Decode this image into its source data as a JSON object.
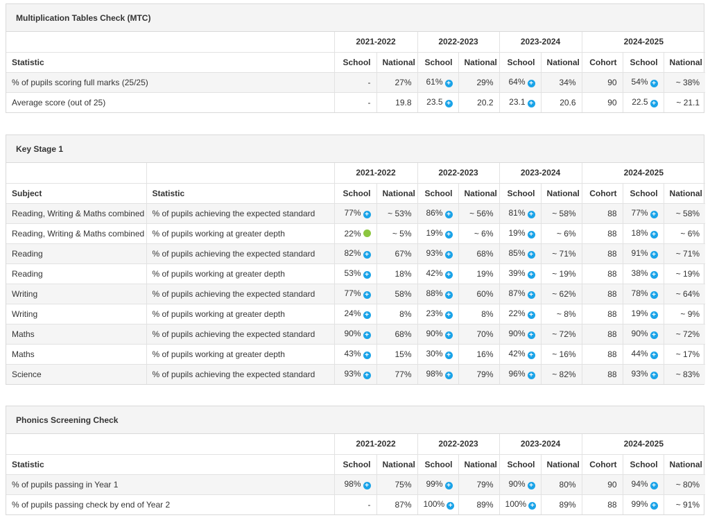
{
  "colors": {
    "info_icon": "#1aa3e8",
    "green_dot": "#8cc63f"
  },
  "years": [
    "2021-2022",
    "2022-2023",
    "2023-2024",
    "2024-2025"
  ],
  "columns": {
    "school": "School",
    "national": "National",
    "cohort": "Cohort"
  },
  "mtc": {
    "title": "Multiplication Tables Check (MTC)",
    "statistic_header": "Statistic",
    "rows": [
      {
        "statistic": "% of pupils scoring full marks (25/25)",
        "cells": [
          {
            "v": "-",
            "icon": ""
          },
          {
            "v": "27%",
            "icon": ""
          },
          {
            "v": "61%",
            "icon": "info-icon"
          },
          {
            "v": "29%",
            "icon": ""
          },
          {
            "v": "64%",
            "icon": "info-icon"
          },
          {
            "v": "34%",
            "icon": ""
          },
          {
            "v": "90",
            "icon": ""
          },
          {
            "v": "54%",
            "icon": "info-icon"
          },
          {
            "v": "~ 38%",
            "icon": ""
          }
        ]
      },
      {
        "statistic": "Average score (out of 25)",
        "cells": [
          {
            "v": "-",
            "icon": ""
          },
          {
            "v": "19.8",
            "icon": ""
          },
          {
            "v": "23.5",
            "icon": "info-icon"
          },
          {
            "v": "20.2",
            "icon": ""
          },
          {
            "v": "23.1",
            "icon": "info-icon"
          },
          {
            "v": "20.6",
            "icon": ""
          },
          {
            "v": "90",
            "icon": ""
          },
          {
            "v": "22.5",
            "icon": "info-icon"
          },
          {
            "v": "~ 21.1",
            "icon": ""
          }
        ]
      }
    ]
  },
  "ks1": {
    "title": "Key Stage 1",
    "subject_header": "Subject",
    "statistic_header": "Statistic",
    "rows": [
      {
        "subject": "Reading, Writing & Maths combined",
        "statistic": "% of pupils achieving the expected standard",
        "cells": [
          {
            "v": "77%",
            "icon": "info-icon"
          },
          {
            "v": "~ 53%",
            "icon": ""
          },
          {
            "v": "86%",
            "icon": "info-icon"
          },
          {
            "v": "~ 56%",
            "icon": ""
          },
          {
            "v": "81%",
            "icon": "info-icon"
          },
          {
            "v": "~ 58%",
            "icon": ""
          },
          {
            "v": "88",
            "icon": ""
          },
          {
            "v": "77%",
            "icon": "info-icon"
          },
          {
            "v": "~ 58%",
            "icon": ""
          }
        ]
      },
      {
        "subject": "Reading, Writing & Maths combined",
        "statistic": "% of pupils working at greater depth",
        "cells": [
          {
            "v": "22%",
            "icon": "green-dot-icon"
          },
          {
            "v": "~ 5%",
            "icon": ""
          },
          {
            "v": "19%",
            "icon": "info-icon"
          },
          {
            "v": "~ 6%",
            "icon": ""
          },
          {
            "v": "19%",
            "icon": "info-icon"
          },
          {
            "v": "~ 6%",
            "icon": ""
          },
          {
            "v": "88",
            "icon": ""
          },
          {
            "v": "18%",
            "icon": "info-icon"
          },
          {
            "v": "~ 6%",
            "icon": ""
          }
        ]
      },
      {
        "subject": "Reading",
        "statistic": "% of pupils achieving the expected standard",
        "cells": [
          {
            "v": "82%",
            "icon": "info-icon"
          },
          {
            "v": "67%",
            "icon": ""
          },
          {
            "v": "93%",
            "icon": "info-icon"
          },
          {
            "v": "68%",
            "icon": ""
          },
          {
            "v": "85%",
            "icon": "info-icon"
          },
          {
            "v": "~ 71%",
            "icon": ""
          },
          {
            "v": "88",
            "icon": ""
          },
          {
            "v": "91%",
            "icon": "info-icon"
          },
          {
            "v": "~ 71%",
            "icon": ""
          }
        ]
      },
      {
        "subject": "Reading",
        "statistic": "% of pupils working at greater depth",
        "cells": [
          {
            "v": "53%",
            "icon": "info-icon"
          },
          {
            "v": "18%",
            "icon": ""
          },
          {
            "v": "42%",
            "icon": "info-icon"
          },
          {
            "v": "19%",
            "icon": ""
          },
          {
            "v": "39%",
            "icon": "info-icon"
          },
          {
            "v": "~ 19%",
            "icon": ""
          },
          {
            "v": "88",
            "icon": ""
          },
          {
            "v": "38%",
            "icon": "info-icon"
          },
          {
            "v": "~ 19%",
            "icon": ""
          }
        ]
      },
      {
        "subject": "Writing",
        "statistic": "% of pupils achieving the expected standard",
        "cells": [
          {
            "v": "77%",
            "icon": "info-icon"
          },
          {
            "v": "58%",
            "icon": ""
          },
          {
            "v": "88%",
            "icon": "info-icon"
          },
          {
            "v": "60%",
            "icon": ""
          },
          {
            "v": "87%",
            "icon": "info-icon"
          },
          {
            "v": "~ 62%",
            "icon": ""
          },
          {
            "v": "88",
            "icon": ""
          },
          {
            "v": "78%",
            "icon": "info-icon"
          },
          {
            "v": "~ 64%",
            "icon": ""
          }
        ]
      },
      {
        "subject": "Writing",
        "statistic": "% of pupils working at greater depth",
        "cells": [
          {
            "v": "24%",
            "icon": "info-icon"
          },
          {
            "v": "8%",
            "icon": ""
          },
          {
            "v": "23%",
            "icon": "info-icon"
          },
          {
            "v": "8%",
            "icon": ""
          },
          {
            "v": "22%",
            "icon": "info-icon"
          },
          {
            "v": "~ 8%",
            "icon": ""
          },
          {
            "v": "88",
            "icon": ""
          },
          {
            "v": "19%",
            "icon": "info-icon"
          },
          {
            "v": "~ 9%",
            "icon": ""
          }
        ]
      },
      {
        "subject": "Maths",
        "statistic": "% of pupils achieving the expected standard",
        "cells": [
          {
            "v": "90%",
            "icon": "info-icon"
          },
          {
            "v": "68%",
            "icon": ""
          },
          {
            "v": "90%",
            "icon": "info-icon"
          },
          {
            "v": "70%",
            "icon": ""
          },
          {
            "v": "90%",
            "icon": "info-icon"
          },
          {
            "v": "~ 72%",
            "icon": ""
          },
          {
            "v": "88",
            "icon": ""
          },
          {
            "v": "90%",
            "icon": "info-icon"
          },
          {
            "v": "~ 72%",
            "icon": ""
          }
        ]
      },
      {
        "subject": "Maths",
        "statistic": "% of pupils working at greater depth",
        "cells": [
          {
            "v": "43%",
            "icon": "info-icon"
          },
          {
            "v": "15%",
            "icon": ""
          },
          {
            "v": "30%",
            "icon": "info-icon"
          },
          {
            "v": "16%",
            "icon": ""
          },
          {
            "v": "42%",
            "icon": "info-icon"
          },
          {
            "v": "~ 16%",
            "icon": ""
          },
          {
            "v": "88",
            "icon": ""
          },
          {
            "v": "44%",
            "icon": "info-icon"
          },
          {
            "v": "~ 17%",
            "icon": ""
          }
        ]
      },
      {
        "subject": "Science",
        "statistic": "% of pupils achieving the expected standard",
        "cells": [
          {
            "v": "93%",
            "icon": "info-icon"
          },
          {
            "v": "77%",
            "icon": ""
          },
          {
            "v": "98%",
            "icon": "info-icon"
          },
          {
            "v": "79%",
            "icon": ""
          },
          {
            "v": "96%",
            "icon": "info-icon"
          },
          {
            "v": "~ 82%",
            "icon": ""
          },
          {
            "v": "88",
            "icon": ""
          },
          {
            "v": "93%",
            "icon": "info-icon"
          },
          {
            "v": "~ 83%",
            "icon": ""
          }
        ]
      }
    ]
  },
  "phonics": {
    "title": "Phonics Screening Check",
    "statistic_header": "Statistic",
    "rows": [
      {
        "statistic": "% of pupils passing in Year 1",
        "cells": [
          {
            "v": "98%",
            "icon": "info-icon"
          },
          {
            "v": "75%",
            "icon": ""
          },
          {
            "v": "99%",
            "icon": "info-icon"
          },
          {
            "v": "79%",
            "icon": ""
          },
          {
            "v": "90%",
            "icon": "info-icon"
          },
          {
            "v": "80%",
            "icon": ""
          },
          {
            "v": "90",
            "icon": ""
          },
          {
            "v": "94%",
            "icon": "info-icon"
          },
          {
            "v": "~ 80%",
            "icon": ""
          }
        ]
      },
      {
        "statistic": "% of pupils passing check by end of Year 2",
        "cells": [
          {
            "v": "-",
            "icon": ""
          },
          {
            "v": "87%",
            "icon": ""
          },
          {
            "v": "100%",
            "icon": "info-icon"
          },
          {
            "v": "89%",
            "icon": ""
          },
          {
            "v": "100%",
            "icon": "info-icon"
          },
          {
            "v": "89%",
            "icon": ""
          },
          {
            "v": "88",
            "icon": ""
          },
          {
            "v": "99%",
            "icon": "info-icon"
          },
          {
            "v": "~ 91%",
            "icon": ""
          }
        ]
      }
    ]
  }
}
